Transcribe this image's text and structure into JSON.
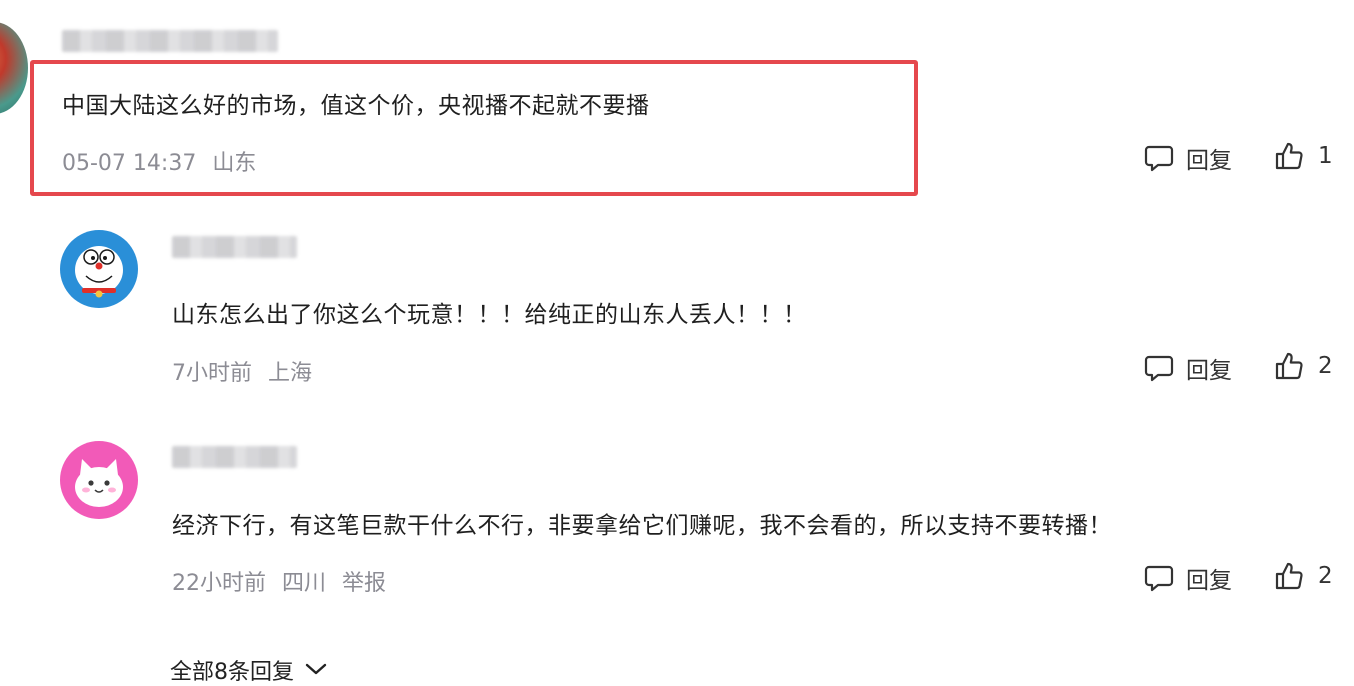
{
  "comments": [
    {
      "content": "中国大陆这么好的市场，值这个价，央视播不起就不要播",
      "time": "05-07 14:37",
      "location": "山东",
      "reply_label": "回复",
      "likes": "1"
    },
    {
      "content": "山东怎么出了你这么个玩意！！！给纯正的山东人丢人！！！",
      "time": "7小时前",
      "location": "上海",
      "reply_label": "回复",
      "likes": "2"
    },
    {
      "content": "经济下行，有这笔巨款干什么不行，非要拿给它们赚呢，我不会看的，所以支持不要转播！",
      "time": "22小时前",
      "location": "四川",
      "report_label": "举报",
      "reply_label": "回复",
      "likes": "2"
    }
  ],
  "expand_replies_label": "全部8条回复",
  "colors": {
    "highlight_border": "#e5484d",
    "meta_text": "#8c8c94",
    "avatar_blue": "#2a8fd8",
    "avatar_pink": "#f25ab8"
  }
}
